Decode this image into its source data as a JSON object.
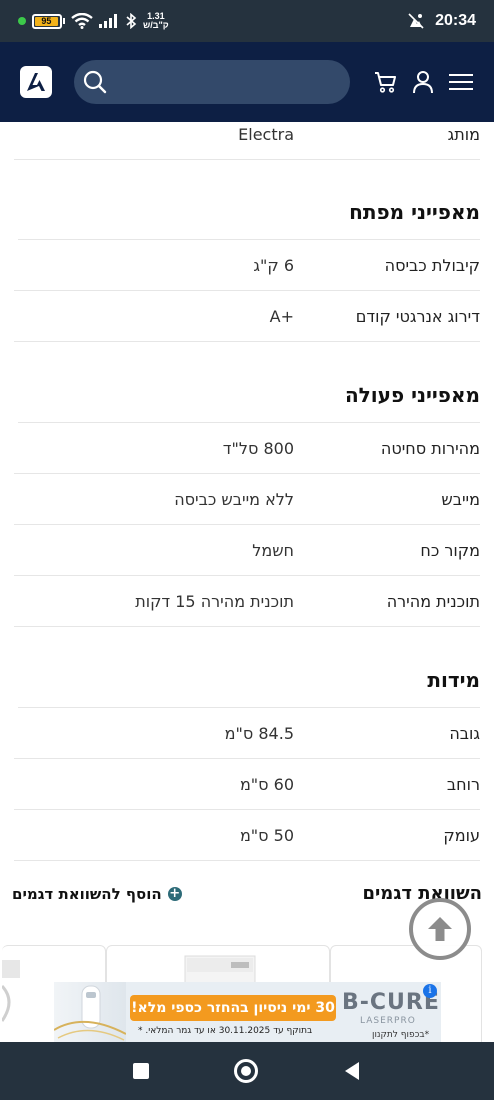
{
  "status_bar": {
    "battery": "95",
    "net_speed_value": "1.31",
    "net_speed_unit": "ק\"ב/ש",
    "time": "20:34"
  },
  "header": {
    "search_placeholder": ""
  },
  "top_row": {
    "label": "מותג",
    "value": "Electra"
  },
  "sections": [
    {
      "title": "מאפייני מפתח",
      "rows": [
        {
          "label": "קיבולת כביסה",
          "value": "6 ק\"ג"
        },
        {
          "label": "דירוג אנרגטי קודם",
          "value": "+A"
        }
      ]
    },
    {
      "title": "מאפייני פעולה",
      "rows": [
        {
          "label": "מהירות סחיטה",
          "value": "800 סל\"ד"
        },
        {
          "label": "מייבש",
          "value": "ללא מייבש כביסה"
        },
        {
          "label": "מקור כח",
          "value": "חשמל"
        },
        {
          "label": "תוכנית מהירה",
          "value": "תוכנית מהירה 15 דקות"
        }
      ]
    },
    {
      "title": "מידות",
      "rows": [
        {
          "label": "גובה",
          "value": "84.5 ס\"מ"
        },
        {
          "label": "רוחב",
          "value": "60 ס\"מ"
        },
        {
          "label": "עומק",
          "value": "50 ס\"מ"
        }
      ]
    }
  ],
  "compare": {
    "title": "השוואת דגמים",
    "add_label": "הוסף להשוואת דגמים"
  },
  "ad": {
    "offer": "30 ימי ניסיון בהחזר כספי מלא!",
    "terms": "בתוקף עד 30.11.2025 או עד גמר המלאי. *",
    "brand": "B-CURE",
    "brand_sub": "LASERPRO",
    "fix_link": "*בכפוף לתקנון"
  }
}
